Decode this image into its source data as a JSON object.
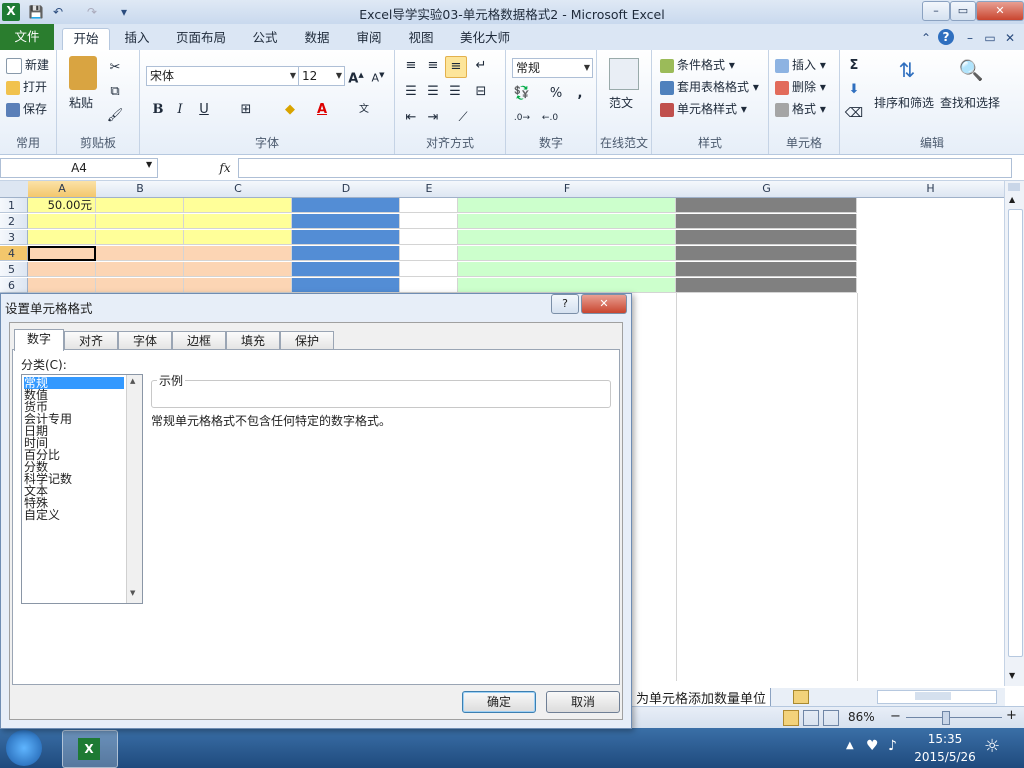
{
  "window": {
    "title": "Excel导学实验03-单元格数据格式2 - Microsoft Excel",
    "app_icon": "X",
    "qat": [
      "save-icon",
      "undo-icon",
      "redo-icon",
      "customize-icon"
    ],
    "controls": {
      "minimize": "–",
      "restore": "▭",
      "close": "✕"
    }
  },
  "ribbon_tabs": [
    {
      "label": "文件"
    },
    {
      "label": "开始"
    },
    {
      "label": "插入"
    },
    {
      "label": "页面布局"
    },
    {
      "label": "公式"
    },
    {
      "label": "数据"
    },
    {
      "label": "审阅"
    },
    {
      "label": "视图"
    },
    {
      "label": "美化大师"
    }
  ],
  "ribbon": {
    "common": {
      "new": "新建",
      "open": "打开",
      "save": "保存",
      "label": "常用"
    },
    "clipboard": {
      "paste": "粘贴",
      "label": "剪贴板"
    },
    "font": {
      "name": "宋体",
      "size": "12",
      "bold": "B",
      "italic": "I",
      "underline": "U",
      "label": "字体"
    },
    "align": {
      "label": "对齐方式"
    },
    "number": {
      "format": "常规",
      "percent": "%",
      "comma": ",",
      "label": "数字"
    },
    "online": {
      "sample": "范文",
      "label": "在线范文"
    },
    "styles": {
      "cond": "条件格式",
      "table": "套用表格格式",
      "cell": "单元格样式",
      "label": "样式"
    },
    "cells": {
      "insert": "插入",
      "delete": "删除",
      "format": "格式",
      "label": "单元格"
    },
    "editing": {
      "sum": "Σ",
      "sort": "排序和筛选",
      "find": "查找和选择",
      "label": "编辑"
    }
  },
  "formula_bar": {
    "name_box": "A4",
    "fx": "fx",
    "value": ""
  },
  "sheet": {
    "columns": [
      "A",
      "B",
      "C",
      "D",
      "E",
      "F",
      "G",
      "H"
    ],
    "rows": [
      "1",
      "2",
      "3",
      "4",
      "5",
      "6"
    ],
    "a1_value": "50.00元",
    "colors": {
      "yellow": "#ffff99",
      "peach": "#fcd5b4",
      "blue": "#538dd5",
      "green": "#ccffcc",
      "gray": "#808080"
    }
  },
  "sheet_tab_label": "为单元格添加数量单位",
  "status": {
    "zoom": "86%",
    "minus": "−",
    "plus": "+"
  },
  "taskbar": {
    "time": "15:35",
    "date": "2015/5/26"
  },
  "dialog": {
    "title": "设置单元格格式",
    "help": "?",
    "close": "✕",
    "tabs": [
      "数字",
      "对齐",
      "字体",
      "边框",
      "填充",
      "保护"
    ],
    "category_label": "分类(C):",
    "categories": [
      "常规",
      "数值",
      "货币",
      "会计专用",
      "日期",
      "时间",
      "百分比",
      "分数",
      "科学记数",
      "文本",
      "特殊",
      "自定义"
    ],
    "selected_category": "常规",
    "sample_label": "示例",
    "description": "常规单元格格式不包含任何特定的数字格式。",
    "ok": "确定",
    "cancel": "取消"
  }
}
